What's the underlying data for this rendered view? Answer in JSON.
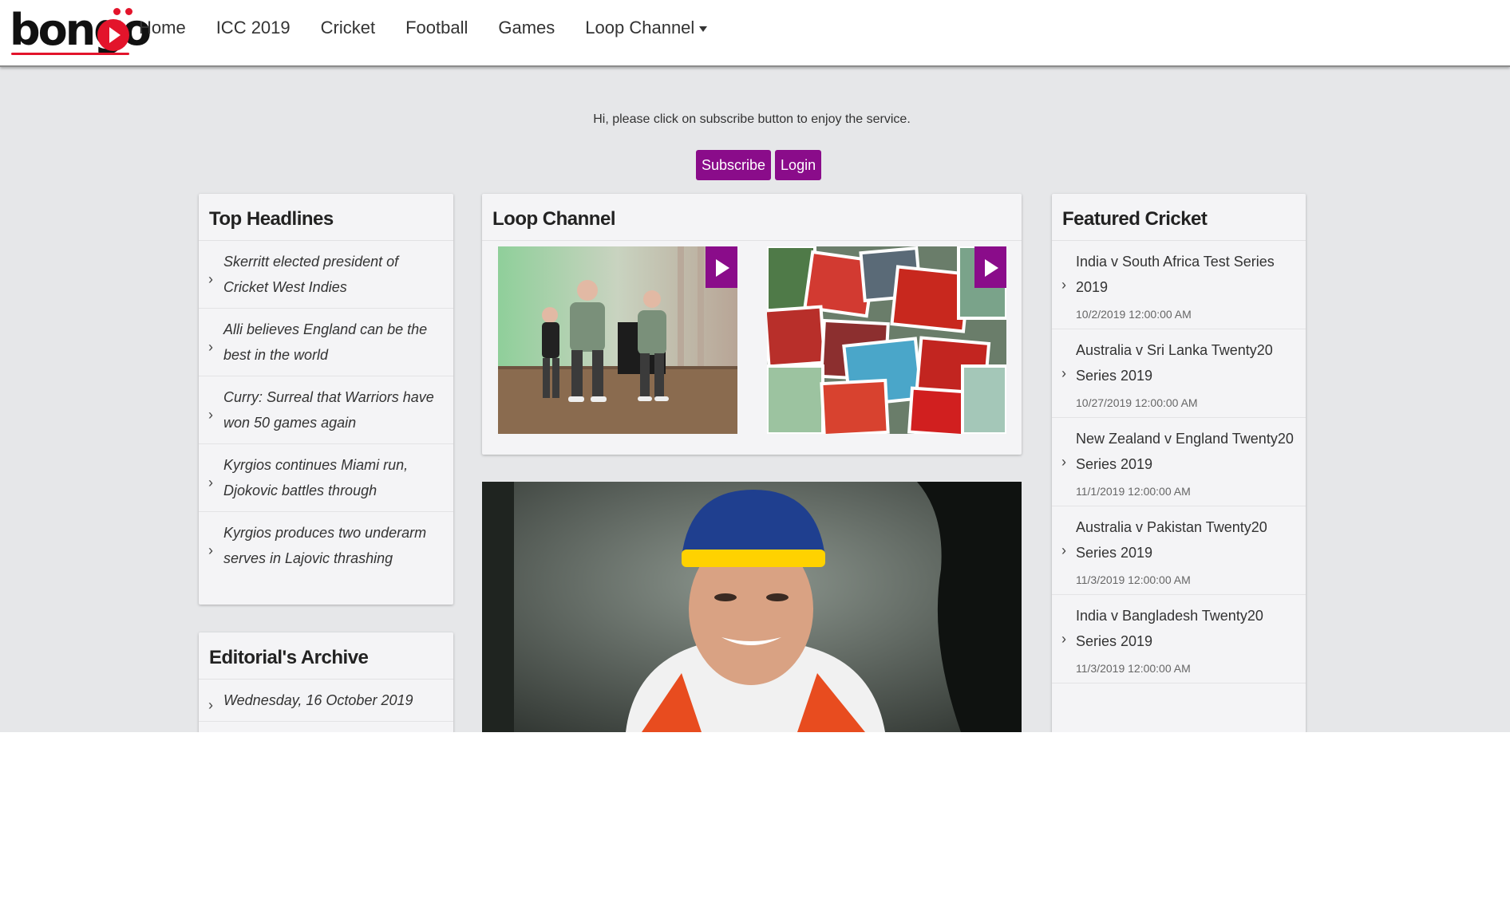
{
  "nav": {
    "logo_text": "bongo",
    "items": [
      "Home",
      "ICC 2019",
      "Cricket",
      "Football",
      "Games",
      "Loop Channel"
    ]
  },
  "subscribe_notice": "Hi, please click on subscribe button to enjoy the service.",
  "buttons": {
    "subscribe": "Subscribe",
    "login": "Login"
  },
  "top_headlines": {
    "title": "Top Headlines",
    "items": [
      "Skerritt elected president of Cricket West Indies",
      "Alli believes England can be the best in the world",
      "Curry: Surreal that Warriors have won 50 games again",
      "Kyrgios continues Miami run, Djokovic battles through",
      "Kyrgios produces two underarm serves in Lajovic thrashing"
    ]
  },
  "editorial_archive": {
    "title": "Editorial's Archive",
    "items": [
      "Wednesday, 16 October 2019"
    ]
  },
  "loop_channel": {
    "title": "Loop Channel"
  },
  "featured_cricket": {
    "title": "Featured Cricket",
    "items": [
      {
        "title": "India v South Africa Test Series 2019",
        "date": "10/2/2019 12:00:00 AM"
      },
      {
        "title": "Australia v Sri Lanka Twenty20 Series 2019",
        "date": "10/27/2019 12:00:00 AM"
      },
      {
        "title": "New Zealand v England Twenty20 Series 2019",
        "date": "11/1/2019 12:00:00 AM"
      },
      {
        "title": "Australia v Pakistan Twenty20 Series 2019",
        "date": "11/3/2019 12:00:00 AM"
      },
      {
        "title": "India v Bangladesh Twenty20 Series 2019",
        "date": "11/3/2019 12:00:00 AM"
      }
    ]
  },
  "colors": {
    "accent": "#8a0c8a",
    "logo_red": "#e3142b",
    "background": "#e6e7e9"
  },
  "icons": [
    "chevron-right-icon",
    "play-icon",
    "caret-down-icon"
  ]
}
